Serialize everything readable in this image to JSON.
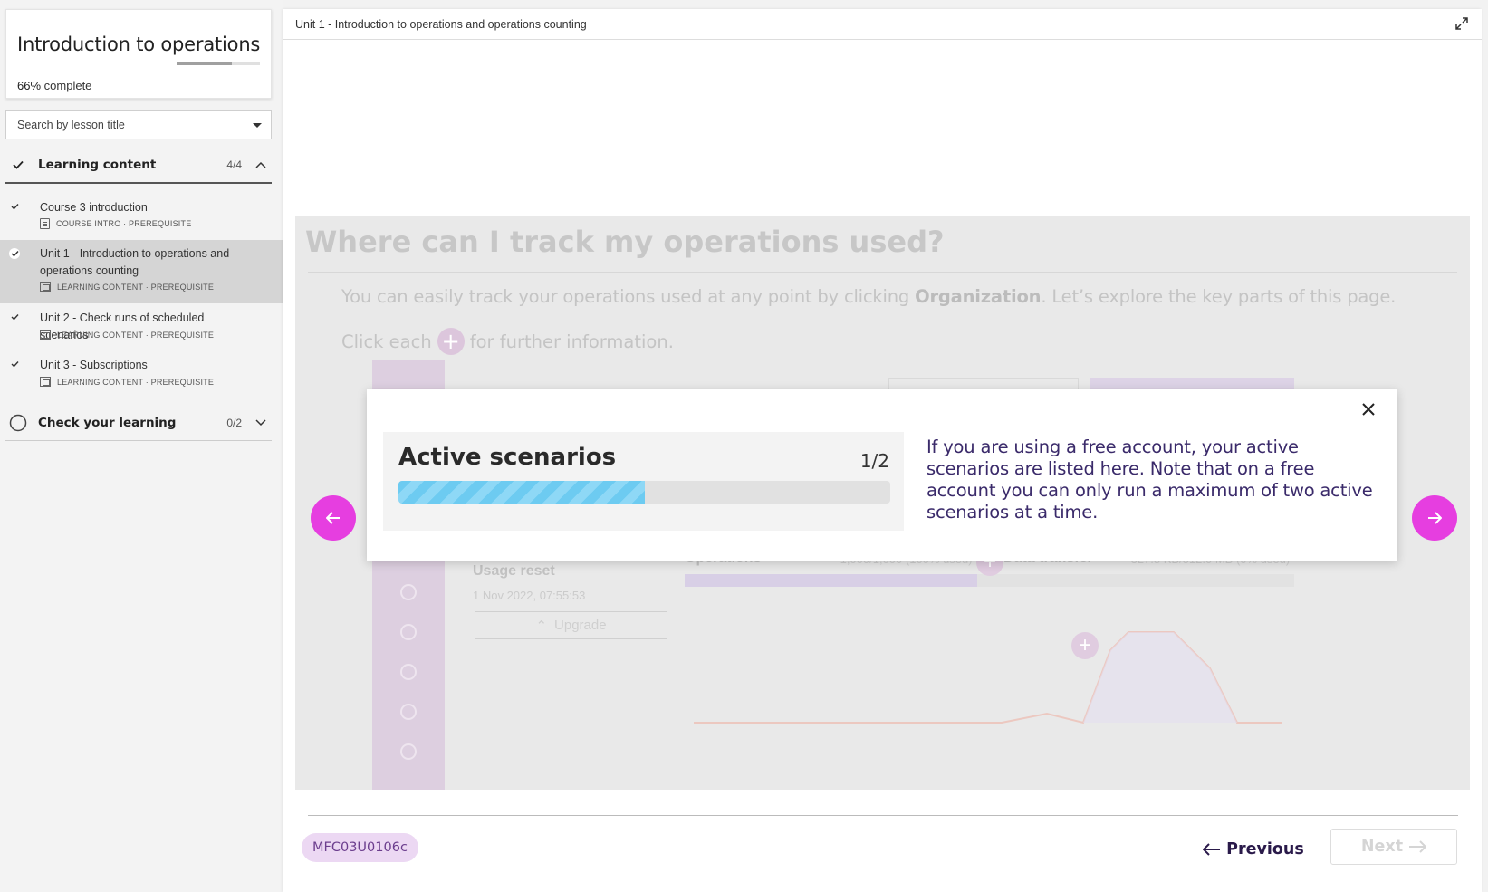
{
  "sidebar": {
    "course_title": "Introduction to operations",
    "progress_percent_label": "66%",
    "progress_fraction": 0.66,
    "complete_suffix": "complete",
    "search_placeholder": "Search by lesson title",
    "sections": [
      {
        "title": "Learning content",
        "count": "4/4",
        "expanded": true,
        "lessons": [
          {
            "title": "Course 3 introduction",
            "meta": "COURSE INTRO · PREREQUISITE",
            "icon": "doc-icon",
            "done": true,
            "active": false
          },
          {
            "title": "Unit 1 - Introduction to operations and operations counting",
            "meta": "LEARNING CONTENT · PREREQUISITE",
            "icon": "slides-icon",
            "done": true,
            "active": true
          },
          {
            "title": "Unit 2 - Check runs of scheduled scenarios",
            "meta": "LEARNING CONTENT · PREREQUISITE",
            "icon": "slides-icon",
            "done": true,
            "active": false
          },
          {
            "title": "Unit 3 - Subscriptions",
            "meta": "LEARNING CONTENT · PREREQUISITE",
            "icon": "slides-icon",
            "done": true,
            "active": false
          }
        ]
      },
      {
        "title": "Check your learning",
        "count": "0/2",
        "expanded": false
      }
    ]
  },
  "main": {
    "header_title": "Unit 1 - Introduction to operations and operations counting",
    "stage": {
      "heading": "Where can I track my operations used?",
      "intro_before": "You can easily track your operations used at any point by clicking ",
      "intro_bold": "Organization",
      "intro_after": ". Let’s explore the key parts of this page.",
      "click_before": "Click each",
      "click_after": "for further information.",
      "bg": {
        "usage_reset": "Usage reset",
        "usage_date": "1 Nov 2022, 07:55:53",
        "upgrade": "Upgrade",
        "operations": "Operations",
        "operations_value": "~1,000/1,000 (100% used)",
        "data_transfer": "Data transfer",
        "data_transfer_value": "~327.8 KB/512.0 MB (0% used)"
      }
    },
    "modal": {
      "figure_title": "Active scenarios",
      "figure_count": "1/2",
      "figure_fraction": 0.5,
      "body": "If you are using a free account, your active scenarios are listed here. Note that on a free account you can only run a maximum of two active scenarios at a time."
    },
    "footer": {
      "code": "MFC03U0106c",
      "previous": "Previous",
      "next": "Next"
    }
  },
  "colors": {
    "accent_magenta": "#e63ee0",
    "modal_text": "#3a2a6a",
    "progress_stripe": "#6dcbf1",
    "chip_bg": "#ecd8f3"
  }
}
